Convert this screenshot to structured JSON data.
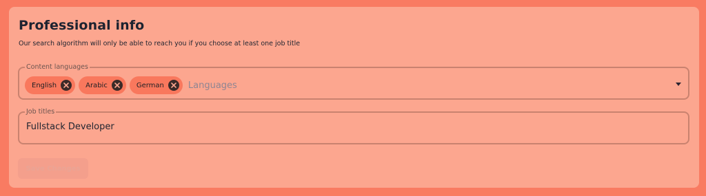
{
  "section": {
    "title": "Professional info",
    "subtitle": "Our search algorithm will only be able to reach you if you choose at least one job title"
  },
  "content_languages": {
    "legend": "Content languages",
    "chips": [
      "English",
      "Arabic",
      "German"
    ],
    "placeholder": "Languages"
  },
  "job_titles": {
    "legend": "Job titles",
    "value": "Fullstack Developer"
  },
  "actions": {
    "save_label": "Save Changes",
    "save_disabled": true
  },
  "colors": {
    "background": "#f97b62",
    "card": "#fca68f",
    "chip": "#f9785d",
    "text": "#1f2430"
  }
}
